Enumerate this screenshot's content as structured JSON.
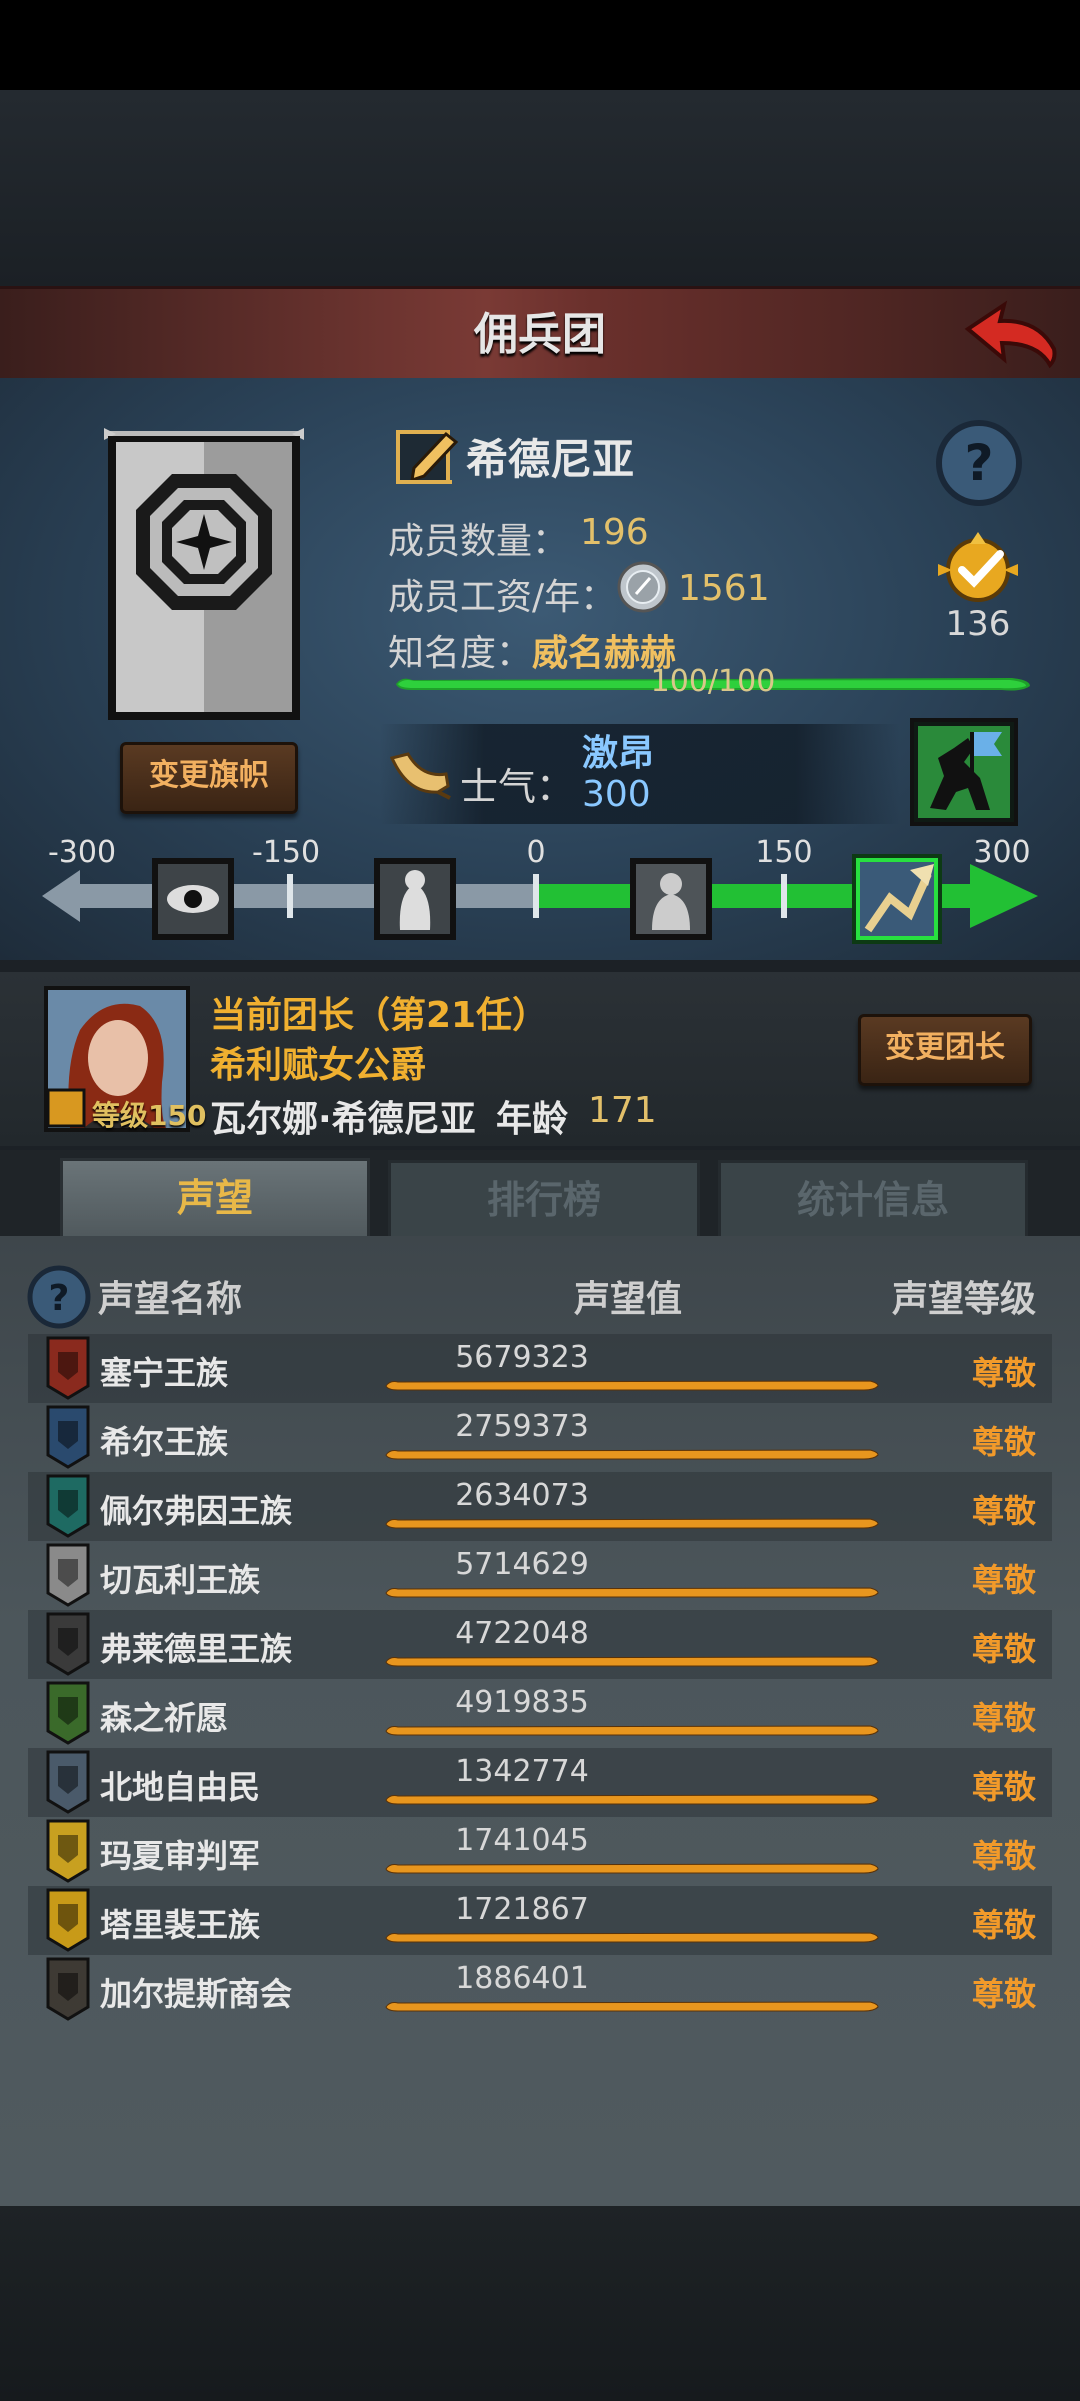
{
  "header": {
    "title": "佣兵团"
  },
  "legion": {
    "name": "希德尼亚",
    "members_label": "成员数量：",
    "members_value": "196",
    "salary_label": "成员工资/年：",
    "salary_value": "1561",
    "fame_label": "知名度：",
    "fame_value": "威名赫赫",
    "fame_progress_text": "100/100",
    "fame_progress": 1.0,
    "badge_value": "136",
    "change_flag_label": "变更旗帜"
  },
  "morale": {
    "label": "士气：",
    "state": "激昂",
    "value": "300",
    "scale": [
      "-300",
      "-150",
      "0",
      "150",
      "300"
    ],
    "current": 300
  },
  "leader": {
    "term": "当前团长（第21任）",
    "title": "希利赋女公爵",
    "level": "等级150",
    "name": "瓦尔娜·希德尼亚",
    "age_label": "年龄",
    "age_value": "171",
    "change_leader_label": "变更团长"
  },
  "tabs": [
    {
      "label": "声望",
      "active": true
    },
    {
      "label": "排行榜",
      "active": false
    },
    {
      "label": "统计信息",
      "active": false
    }
  ],
  "reputation": {
    "headers": {
      "name": "声望名称",
      "value": "声望值",
      "level": "声望等级"
    },
    "rows": [
      {
        "name": "塞宁王族",
        "value": "5679323",
        "level": "尊敬",
        "color": "#8a2a1e"
      },
      {
        "name": "希尔王族",
        "value": "2759373",
        "level": "尊敬",
        "color": "#2a4a6e"
      },
      {
        "name": "佩尔弗因王族",
        "value": "2634073",
        "level": "尊敬",
        "color": "#1e6a62"
      },
      {
        "name": "切瓦利王族",
        "value": "5714629",
        "level": "尊敬",
        "color": "#8a8a8a"
      },
      {
        "name": "弗莱德里王族",
        "value": "4722048",
        "level": "尊敬",
        "color": "#3a3a3a"
      },
      {
        "name": "森之祈愿",
        "value": "4919835",
        "level": "尊敬",
        "color": "#3a6a2a"
      },
      {
        "name": "北地自由民",
        "value": "1342774",
        "level": "尊敬",
        "color": "#4a5a6a"
      },
      {
        "name": "玛夏审判军",
        "value": "1741045",
        "level": "尊敬",
        "color": "#c8a020"
      },
      {
        "name": "塔里裴王族",
        "value": "1721867",
        "level": "尊敬",
        "color": "#c89a18"
      },
      {
        "name": "加尔提斯商会",
        "value": "1886401",
        "level": "尊敬",
        "color": "#3e3a34"
      }
    ]
  },
  "colors": {
    "accent": "#f0b030",
    "morale_green": "#22c034",
    "rep_orange": "#e8961e"
  }
}
